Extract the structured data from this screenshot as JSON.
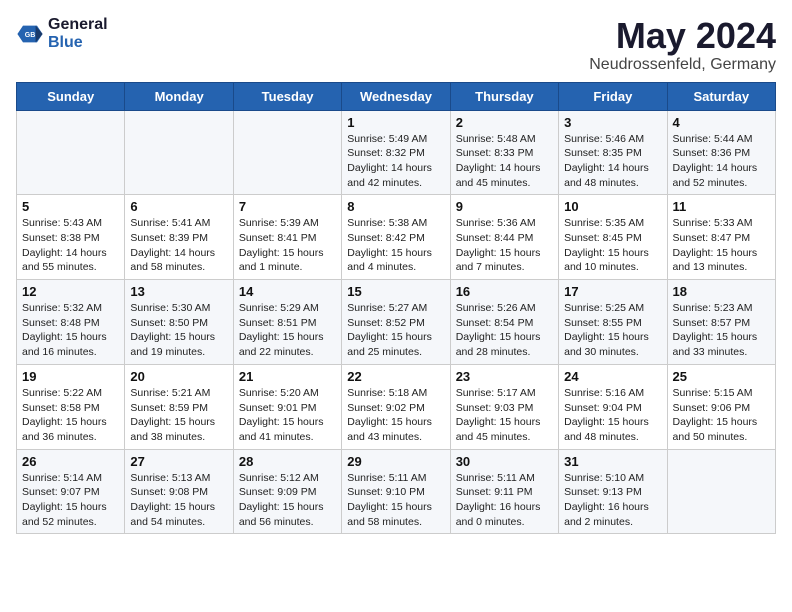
{
  "header": {
    "logo_line1": "General",
    "logo_line2": "Blue",
    "month": "May 2024",
    "location": "Neudrossenfeld, Germany"
  },
  "weekdays": [
    "Sunday",
    "Monday",
    "Tuesday",
    "Wednesday",
    "Thursday",
    "Friday",
    "Saturday"
  ],
  "weeks": [
    [
      {
        "day": "",
        "info": ""
      },
      {
        "day": "",
        "info": ""
      },
      {
        "day": "",
        "info": ""
      },
      {
        "day": "1",
        "info": "Sunrise: 5:49 AM\nSunset: 8:32 PM\nDaylight: 14 hours\nand 42 minutes."
      },
      {
        "day": "2",
        "info": "Sunrise: 5:48 AM\nSunset: 8:33 PM\nDaylight: 14 hours\nand 45 minutes."
      },
      {
        "day": "3",
        "info": "Sunrise: 5:46 AM\nSunset: 8:35 PM\nDaylight: 14 hours\nand 48 minutes."
      },
      {
        "day": "4",
        "info": "Sunrise: 5:44 AM\nSunset: 8:36 PM\nDaylight: 14 hours\nand 52 minutes."
      }
    ],
    [
      {
        "day": "5",
        "info": "Sunrise: 5:43 AM\nSunset: 8:38 PM\nDaylight: 14 hours\nand 55 minutes."
      },
      {
        "day": "6",
        "info": "Sunrise: 5:41 AM\nSunset: 8:39 PM\nDaylight: 14 hours\nand 58 minutes."
      },
      {
        "day": "7",
        "info": "Sunrise: 5:39 AM\nSunset: 8:41 PM\nDaylight: 15 hours\nand 1 minute."
      },
      {
        "day": "8",
        "info": "Sunrise: 5:38 AM\nSunset: 8:42 PM\nDaylight: 15 hours\nand 4 minutes."
      },
      {
        "day": "9",
        "info": "Sunrise: 5:36 AM\nSunset: 8:44 PM\nDaylight: 15 hours\nand 7 minutes."
      },
      {
        "day": "10",
        "info": "Sunrise: 5:35 AM\nSunset: 8:45 PM\nDaylight: 15 hours\nand 10 minutes."
      },
      {
        "day": "11",
        "info": "Sunrise: 5:33 AM\nSunset: 8:47 PM\nDaylight: 15 hours\nand 13 minutes."
      }
    ],
    [
      {
        "day": "12",
        "info": "Sunrise: 5:32 AM\nSunset: 8:48 PM\nDaylight: 15 hours\nand 16 minutes."
      },
      {
        "day": "13",
        "info": "Sunrise: 5:30 AM\nSunset: 8:50 PM\nDaylight: 15 hours\nand 19 minutes."
      },
      {
        "day": "14",
        "info": "Sunrise: 5:29 AM\nSunset: 8:51 PM\nDaylight: 15 hours\nand 22 minutes."
      },
      {
        "day": "15",
        "info": "Sunrise: 5:27 AM\nSunset: 8:52 PM\nDaylight: 15 hours\nand 25 minutes."
      },
      {
        "day": "16",
        "info": "Sunrise: 5:26 AM\nSunset: 8:54 PM\nDaylight: 15 hours\nand 28 minutes."
      },
      {
        "day": "17",
        "info": "Sunrise: 5:25 AM\nSunset: 8:55 PM\nDaylight: 15 hours\nand 30 minutes."
      },
      {
        "day": "18",
        "info": "Sunrise: 5:23 AM\nSunset: 8:57 PM\nDaylight: 15 hours\nand 33 minutes."
      }
    ],
    [
      {
        "day": "19",
        "info": "Sunrise: 5:22 AM\nSunset: 8:58 PM\nDaylight: 15 hours\nand 36 minutes."
      },
      {
        "day": "20",
        "info": "Sunrise: 5:21 AM\nSunset: 8:59 PM\nDaylight: 15 hours\nand 38 minutes."
      },
      {
        "day": "21",
        "info": "Sunrise: 5:20 AM\nSunset: 9:01 PM\nDaylight: 15 hours\nand 41 minutes."
      },
      {
        "day": "22",
        "info": "Sunrise: 5:18 AM\nSunset: 9:02 PM\nDaylight: 15 hours\nand 43 minutes."
      },
      {
        "day": "23",
        "info": "Sunrise: 5:17 AM\nSunset: 9:03 PM\nDaylight: 15 hours\nand 45 minutes."
      },
      {
        "day": "24",
        "info": "Sunrise: 5:16 AM\nSunset: 9:04 PM\nDaylight: 15 hours\nand 48 minutes."
      },
      {
        "day": "25",
        "info": "Sunrise: 5:15 AM\nSunset: 9:06 PM\nDaylight: 15 hours\nand 50 minutes."
      }
    ],
    [
      {
        "day": "26",
        "info": "Sunrise: 5:14 AM\nSunset: 9:07 PM\nDaylight: 15 hours\nand 52 minutes."
      },
      {
        "day": "27",
        "info": "Sunrise: 5:13 AM\nSunset: 9:08 PM\nDaylight: 15 hours\nand 54 minutes."
      },
      {
        "day": "28",
        "info": "Sunrise: 5:12 AM\nSunset: 9:09 PM\nDaylight: 15 hours\nand 56 minutes."
      },
      {
        "day": "29",
        "info": "Sunrise: 5:11 AM\nSunset: 9:10 PM\nDaylight: 15 hours\nand 58 minutes."
      },
      {
        "day": "30",
        "info": "Sunrise: 5:11 AM\nSunset: 9:11 PM\nDaylight: 16 hours\nand 0 minutes."
      },
      {
        "day": "31",
        "info": "Sunrise: 5:10 AM\nSunset: 9:13 PM\nDaylight: 16 hours\nand 2 minutes."
      },
      {
        "day": "",
        "info": ""
      }
    ]
  ]
}
